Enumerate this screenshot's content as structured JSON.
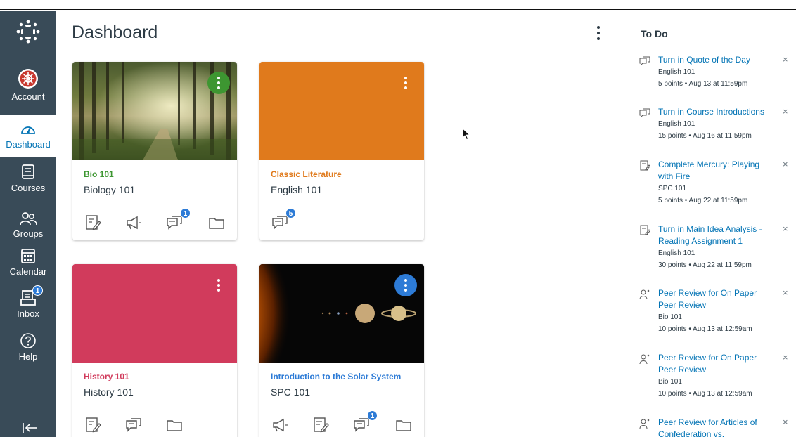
{
  "nav": {
    "items": [
      {
        "label": "Account",
        "icon": "account-avatar-icon"
      },
      {
        "label": "Dashboard",
        "icon": "dashboard-icon"
      },
      {
        "label": "Courses",
        "icon": "courses-icon"
      },
      {
        "label": "Groups",
        "icon": "groups-icon"
      },
      {
        "label": "Calendar",
        "icon": "calendar-icon"
      },
      {
        "label": "Inbox",
        "icon": "inbox-icon",
        "badge": "1"
      },
      {
        "label": "Help",
        "icon": "help-icon"
      }
    ],
    "collapse_icon": "collapse-arrow-icon"
  },
  "main": {
    "title": "Dashboard"
  },
  "cards": [
    {
      "name": "Bio 101",
      "code": "Biology 101",
      "color": "#3d9631",
      "hero": "forest-image",
      "unread": "1"
    },
    {
      "name": "Classic Literature",
      "code": "English 101",
      "color": "#e07a1c",
      "hero": "orange",
      "unread": "5"
    },
    {
      "name": "History 101",
      "code": "History 101",
      "color": "#d13b5c",
      "hero": "crimson"
    },
    {
      "name": "Introduction to the Solar System",
      "code": "SPC 101",
      "color": "#2d7bd6",
      "hero": "solar-system-image",
      "unread": "1"
    }
  ],
  "todo": {
    "title": "To Do",
    "items": [
      {
        "title": "Turn in Quote of the Day",
        "course": "English 101",
        "meta": "5 points • Aug 13 at 11:59pm",
        "icon": "discussion-icon"
      },
      {
        "title": "Turn in Course Introductions",
        "course": "English 101",
        "meta": "15 points • Aug 16 at 11:59pm",
        "icon": "discussion-icon"
      },
      {
        "title": "Complete Mercury: Playing with Fire",
        "course": "SPC 101",
        "meta": "5 points • Aug 22 at 11:59pm",
        "icon": "assignment-icon"
      },
      {
        "title": "Turn in Main Idea Analysis - Reading Assignment 1",
        "course": "English 101",
        "meta": "30 points • Aug 22 at 11:59pm",
        "icon": "assignment-icon"
      },
      {
        "title": "Peer Review for On Paper Peer Review",
        "course": "Bio 101",
        "meta": "10 points • Aug 13 at 12:59am",
        "icon": "peer-review-icon"
      },
      {
        "title": "Peer Review for On Paper Peer Review",
        "course": "Bio 101",
        "meta": "10 points • Aug 13 at 12:59am",
        "icon": "peer-review-icon"
      },
      {
        "title": "Peer Review for Articles of Confederation vs.",
        "icon": "peer-review-icon"
      }
    ],
    "close_glyph": "×"
  },
  "colors": {
    "nav_bg": "#394b58",
    "link": "#0374b5",
    "text": "#2d3b45"
  }
}
